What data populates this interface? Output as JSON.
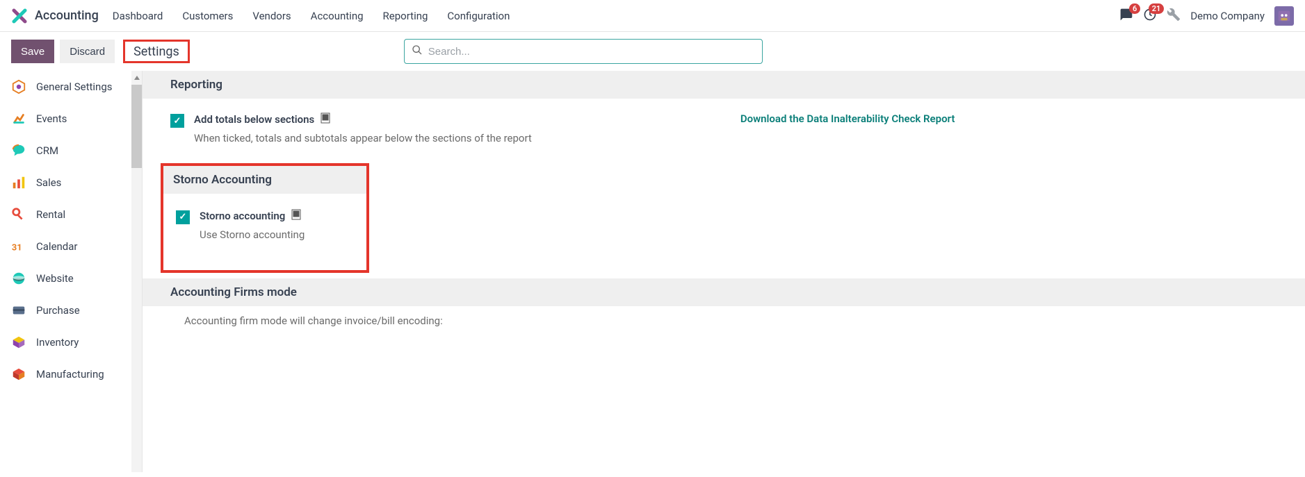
{
  "app": {
    "name": "Accounting"
  },
  "nav": {
    "items": [
      {
        "label": "Dashboard"
      },
      {
        "label": "Customers"
      },
      {
        "label": "Vendors"
      },
      {
        "label": "Accounting"
      },
      {
        "label": "Reporting"
      },
      {
        "label": "Configuration"
      }
    ]
  },
  "topright": {
    "messages_badge": "6",
    "activities_badge": "21",
    "company": "Demo Company"
  },
  "controlbar": {
    "save_label": "Save",
    "discard_label": "Discard",
    "breadcrumb": "Settings",
    "search_placeholder": "Search..."
  },
  "sidebar": {
    "items": [
      {
        "label": "General Settings"
      },
      {
        "label": "Events"
      },
      {
        "label": "CRM"
      },
      {
        "label": "Sales"
      },
      {
        "label": "Rental"
      },
      {
        "label": "Calendar"
      },
      {
        "label": "Website"
      },
      {
        "label": "Purchase"
      },
      {
        "label": "Inventory"
      },
      {
        "label": "Manufacturing"
      }
    ]
  },
  "sections": {
    "reporting": {
      "title": "Reporting",
      "option1_title": "Add totals below sections",
      "option1_desc": "When ticked, totals and subtotals appear below the sections of the report",
      "download_link": "Download the Data Inalterability Check Report"
    },
    "storno": {
      "title": "Storno Accounting",
      "option_title": "Storno accounting",
      "option_desc": "Use Storno accounting"
    },
    "firms": {
      "title": "Accounting Firms mode",
      "desc": "Accounting firm mode will change invoice/bill encoding:"
    }
  }
}
